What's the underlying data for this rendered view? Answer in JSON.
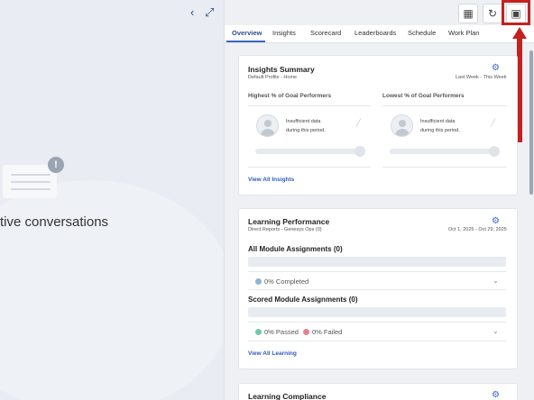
{
  "left_panel": {
    "back_icon": "chevron-left-icon",
    "expand_icon": "expand-icon",
    "info_badge": "!",
    "conversations_text": "tive conversations"
  },
  "toolbar": {
    "buttons": [
      "layout-icon",
      "refresh-icon",
      "popout-window-icon"
    ],
    "highlight_color": "#c4221f"
  },
  "tabs": [
    "Overview",
    "Insights",
    "Scorecard",
    "Leaderboards",
    "Schedule",
    "Work Plan"
  ],
  "active_tab": "Overview",
  "insights_summary": {
    "title": "Insights Summary",
    "profile": "Default Profile - Home",
    "period": "Last Week - This Week",
    "columns": [
      {
        "title": "Highest % of Goal Performers",
        "message_line1": "Insufficient data",
        "message_line2": "during this period."
      },
      {
        "title": "Lowest % of Goal Performers",
        "message_line1": "Insufficient data",
        "message_line2": "during this period."
      }
    ],
    "link": "View All Insights"
  },
  "learning_performance": {
    "title": "Learning Performance",
    "subtitle": "Direct Reports - Genesys Ops (0)",
    "date_range": "Oct 1, 2025 - Oct 29, 2025",
    "all_modules": {
      "title": "All Module Assignments (0)",
      "completed": "0% Completed",
      "completed_color": "#8fb4d4"
    },
    "scored_modules": {
      "title": "Scored Module Assignments (0)",
      "passed": "0% Passed",
      "passed_color": "#6cc9a8",
      "failed": "0% Failed",
      "failed_color": "#e8808f"
    },
    "link": "View All Learning"
  },
  "learning_compliance": {
    "title": "Learning Compliance"
  },
  "colors": {
    "accent": "#3a67c7",
    "link": "#2d5bbf"
  }
}
